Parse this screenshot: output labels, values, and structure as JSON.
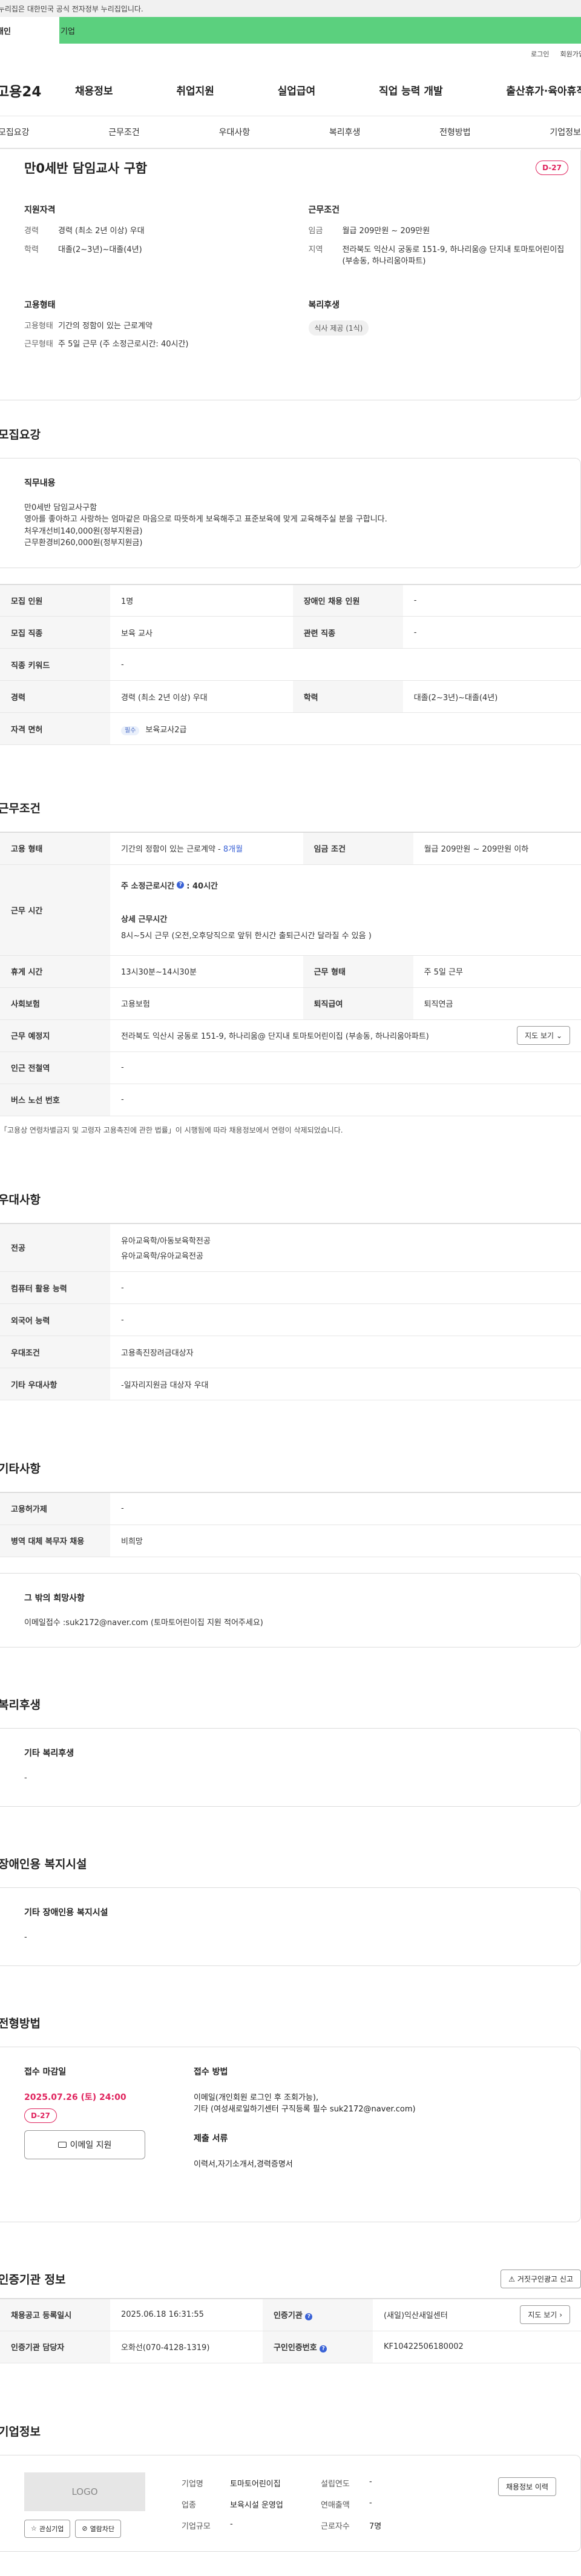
{
  "gov_bar": "이 누리집은 대한민국 공식 전자정부 누리집입니다.",
  "user_tabs": {
    "personal": "개인",
    "company": "기업"
  },
  "util": {
    "login": "로그인",
    "join": "회원가입"
  },
  "gnb": {
    "logo": "고용24",
    "items": [
      "채용정보",
      "취업지원",
      "실업급여",
      "직업 능력 개발",
      "출산휴가·육아휴직"
    ]
  },
  "subnav": [
    "모집요강",
    "근무조건",
    "우대사항",
    "복리후생",
    "전형방법",
    "기업정보"
  ],
  "summary": {
    "title": "만0세반 담임교사 구함",
    "dday": "D-27",
    "qual": {
      "heading": "지원자격",
      "career_k": "경력",
      "career_v": "경력 (최소 2년 이상) 우대",
      "edu_k": "학력",
      "edu_v": "대졸(2~3년)~대졸(4년)"
    },
    "work": {
      "heading": "근무조건",
      "wage_k": "임금",
      "wage_v": "월급 209만원 ~ 209만원",
      "region_k": "지역",
      "region_v": "전라북도 익산시 궁동로 151-9, 하나리움@ 단지내 토마토어린이집 (부송동, 하나리움아파트)"
    },
    "employ": {
      "heading": "고용형태",
      "type_k": "고용형태",
      "type_v": "기간의 정함이 있는 근로계약",
      "form_k": "근무형태",
      "form_v": "주 5일 근무 (주 소정근로시간: 40시간)"
    },
    "welfare": {
      "heading": "복리후생",
      "chip": "식사 제공 (1식)"
    }
  },
  "recruit": {
    "title": "모집요강",
    "duty_heading": "직무내용",
    "duty_lines": [
      "만0세반 담임교사구함",
      "영아를 좋아하고 사랑하는 엄마같은 마음으로 따뜻하게 보육해주고 표준보육에 맞게 교육해주실 분을 구합니다.",
      "처우개선비140,000원(정부지원금)",
      "근무환경비260,000원(정부지원금)"
    ],
    "rows": {
      "count_k": "모집 인원",
      "count_v": "1명",
      "disabled_k": "장애인 채용 인원",
      "disabled_v": "-",
      "job_k": "모집 직종",
      "job_v": "보육 교사",
      "related_k": "관련 직종",
      "related_v": "-",
      "keyword_k": "직종 키워드",
      "keyword_v": "-",
      "career_k": "경력",
      "career_v": "경력 (최소 2년 이상) 우대",
      "edu_k": "학력",
      "edu_v": "대졸(2~3년)~대졸(4년)",
      "license_k": "자격 면허",
      "license_badge": "필수",
      "license_v": "보육교사2급"
    }
  },
  "conditions": {
    "title": "근무조건",
    "type_k": "고용 형태",
    "type_v": "기간의 정함이 있는 근로계약 - ",
    "type_v2": "8개월",
    "wage_k": "임금 조건",
    "wage_v": "월급 209만원 ~ 209만원 이하",
    "hours_k": "근무 시간",
    "hours_week": "주 소정근로시간",
    "hours_week_v": ": 40시간",
    "hours_detail_h": "상세 근무시간",
    "hours_detail_v": "8시~5시 근무 (오전,오후당직으로 앞뒤 한시간 출퇴근시간 달라질 수 있음 )",
    "break_k": "휴게 시간",
    "break_v": "13시30분~14시30분",
    "form_k": "근무 형태",
    "form_v": "주 5일 근무",
    "insure_k": "사회보험",
    "insure_v": "고용보험",
    "retire_k": "퇴직급여",
    "retire_v": "퇴직연금",
    "place_k": "근무 예정지",
    "place_v": "전라북도 익산시 궁동로 151-9, 하나리움@ 단지내 토마토어린이집 (부송동, 하나리움아파트)",
    "map_btn": "지도 보기",
    "station_k": "인근 전철역",
    "station_v": "-",
    "bus_k": "버스 노선 번호",
    "bus_v": "-",
    "note": "「고용상 연령차별금지 및 고령자 고용촉진에 관한 법률」이 시행됨에 따라 채용정보에서 연령이 삭제되었습니다."
  },
  "preference": {
    "title": "우대사항",
    "major_k": "전공",
    "major_v1": "유아교육학/아동보육학전공",
    "major_v2": "유아교육학/유아교육전공",
    "pc_k": "컴퓨터 활용 능력",
    "pc_v": "-",
    "lang_k": "외국어 능력",
    "lang_v": "-",
    "cond_k": "우대조건",
    "cond_v": "고용촉진장려금대상자",
    "etc_k": "기타 우대사항",
    "etc_v": "-일자리지원금 대상자 우대"
  },
  "others": {
    "title": "기타사항",
    "permit_k": "고용허가제",
    "permit_v": "-",
    "military_k": "병역 대체 복무자 채용",
    "military_v": "비희망",
    "hope_h": "그 밖의 희망사항",
    "hope_v": "이메일접수 :suk2172@naver.com (토마토어린이집 지원 적어주세요)"
  },
  "welfare": {
    "title": "복리후생",
    "h": "기타 복리후생",
    "v": "-"
  },
  "facility": {
    "title": "장애인용 복지시설",
    "h": "기타 장애인용 복지시설",
    "v": "-"
  },
  "method": {
    "title": "전형방법",
    "deadline_h": "접수 마감일",
    "deadline_v": "2025.07.26 (토) 24:00",
    "dday": "D-27",
    "email_btn": "이메일 지원",
    "apply_h": "접수 방법",
    "apply_v1": "이메일(개인회원 로그인 후 조회가능),",
    "apply_v2": "기타 (여성새로일하기센터 구직등록 필수 suk2172@naver.com)",
    "docs_h": "제출 서류",
    "docs_v": "이력서,자기소개서,경력증명서"
  },
  "auth": {
    "title": "인증기관 정보",
    "report_btn": "거짓구인광고 신고",
    "date_k": "채용공고 등록일시",
    "date_v": "2025.06.18 16:31:55",
    "org_k": "인증기관",
    "org_v": "(새일)익산새일센터",
    "map_btn": "지도 보기",
    "mgr_k": "인증기관 담당자",
    "mgr_v": "오화선(070-4128-1319)",
    "no_k": "구인인증번호",
    "no_v": "KF10422506180002"
  },
  "company": {
    "title": "기업정보",
    "logo": "LOGO",
    "info_btn": "채용정보 이력",
    "fav_btn": "관심기업",
    "block_btn": "열람차단",
    "name_k": "기업명",
    "name_v": "토마토어린이집",
    "year_k": "설립연도",
    "year_v": "-",
    "ind_k": "업종",
    "ind_v": "보육시설 운영업",
    "sales_k": "연매출액",
    "sales_v": "-",
    "size_k": "기업규모",
    "size_v": "-",
    "emp_k": "근로자수",
    "emp_v": "7명"
  }
}
